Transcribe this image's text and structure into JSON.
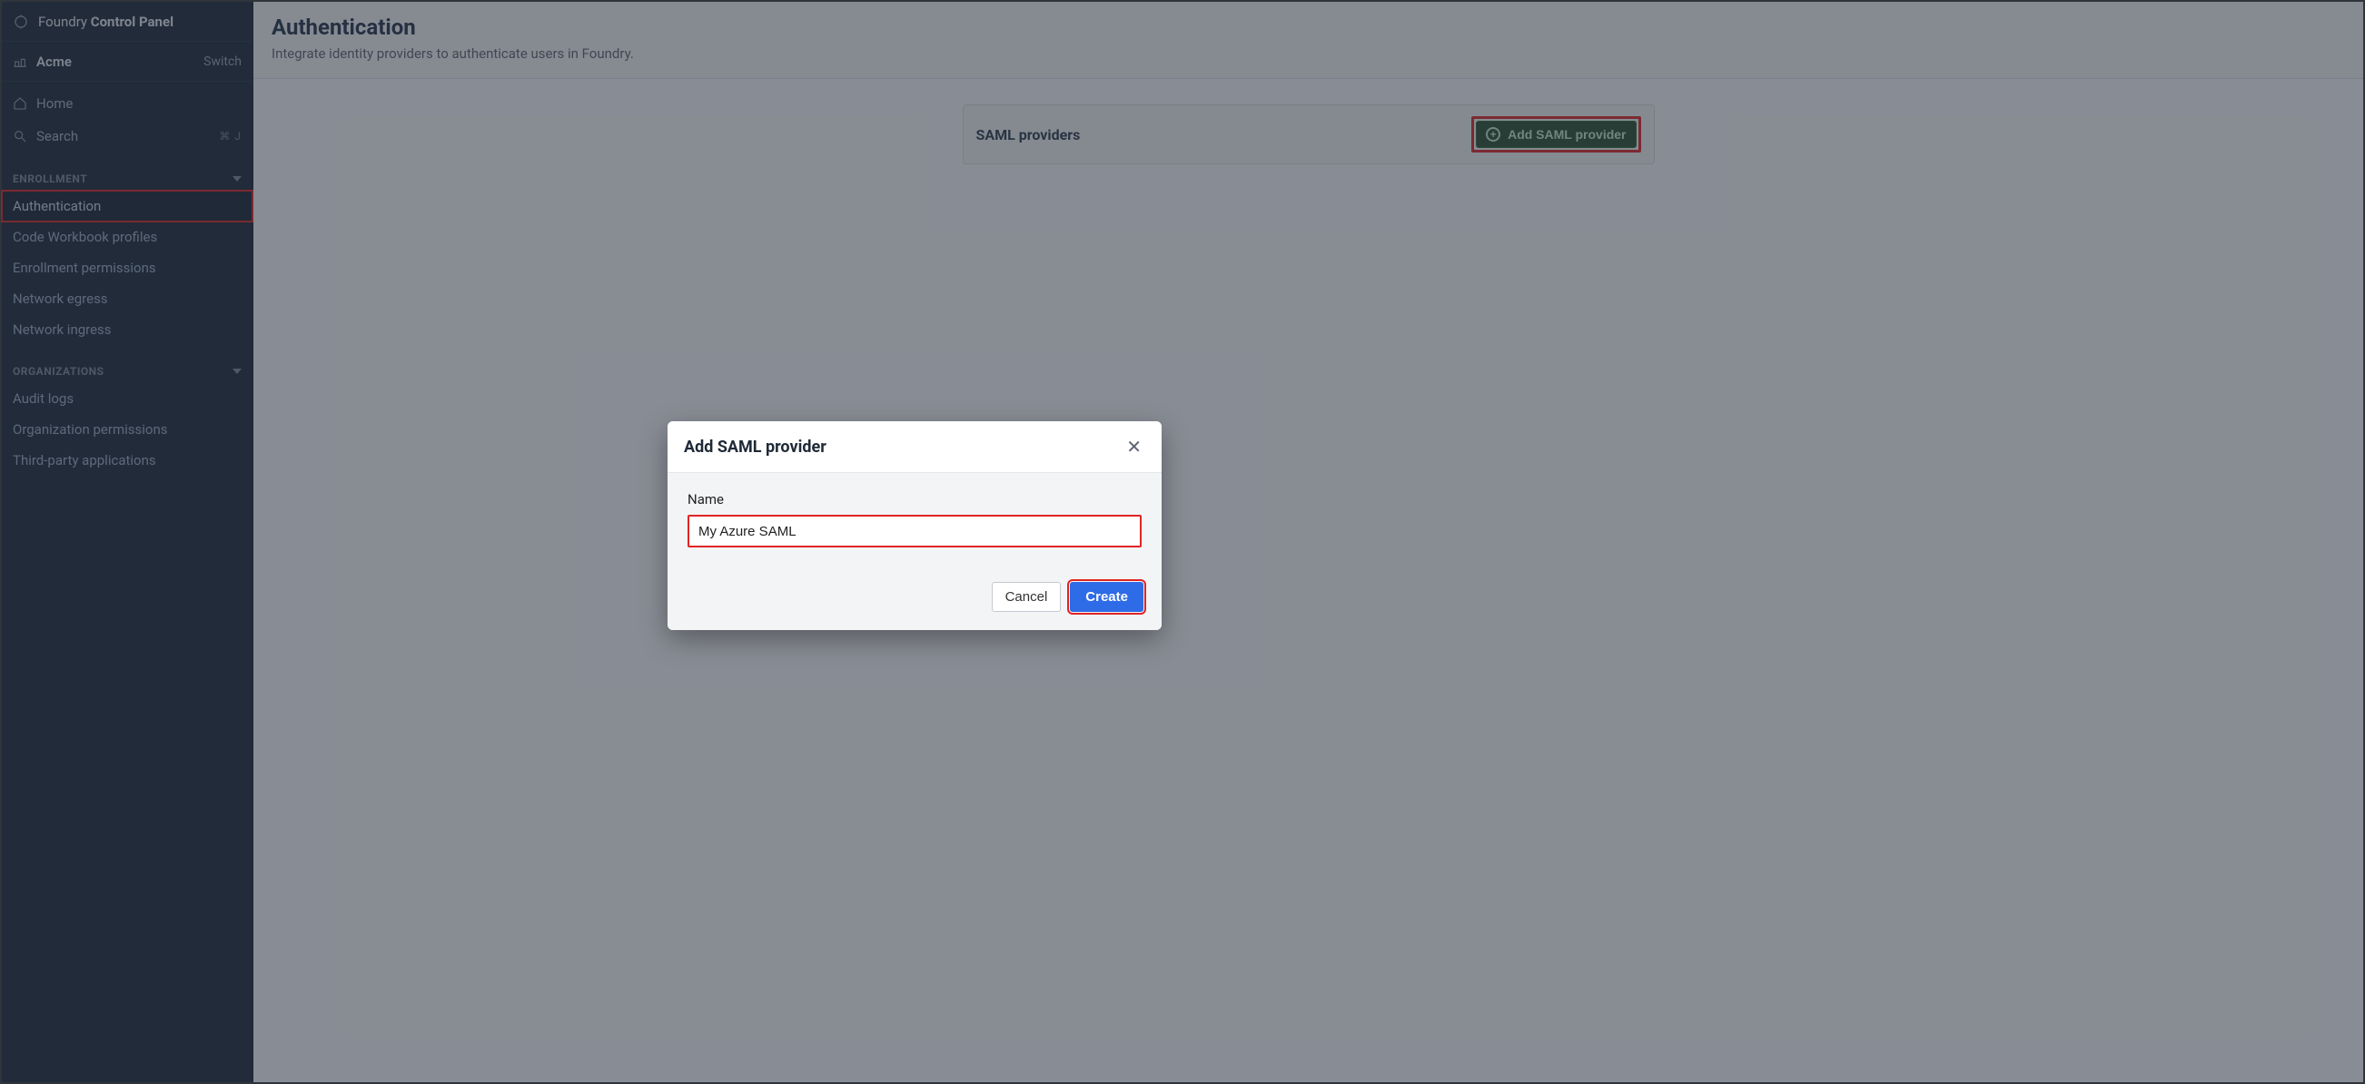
{
  "app": {
    "name_prefix": "Foundry ",
    "name_bold": "Control Panel"
  },
  "org": {
    "name": "Acme",
    "switch_label": "Switch"
  },
  "sidebar": {
    "home_label": "Home",
    "search_label": "Search",
    "search_kbd": "⌘ J",
    "sections": [
      {
        "title": "ENROLLMENT",
        "items": [
          {
            "label": "Authentication"
          },
          {
            "label": "Code Workbook profiles"
          },
          {
            "label": "Enrollment permissions"
          },
          {
            "label": "Network egress"
          },
          {
            "label": "Network ingress"
          }
        ]
      },
      {
        "title": "ORGANIZATIONS",
        "items": [
          {
            "label": "Audit logs"
          },
          {
            "label": "Organization permissions"
          },
          {
            "label": "Third-party applications"
          }
        ]
      }
    ]
  },
  "page": {
    "title": "Authentication",
    "subtitle": "Integrate identity providers to authenticate users in Foundry."
  },
  "saml_card": {
    "title": "SAML providers",
    "add_button": "Add SAML provider"
  },
  "modal": {
    "title": "Add SAML provider",
    "name_label": "Name",
    "name_value": "My Azure SAML",
    "cancel": "Cancel",
    "create": "Create"
  }
}
